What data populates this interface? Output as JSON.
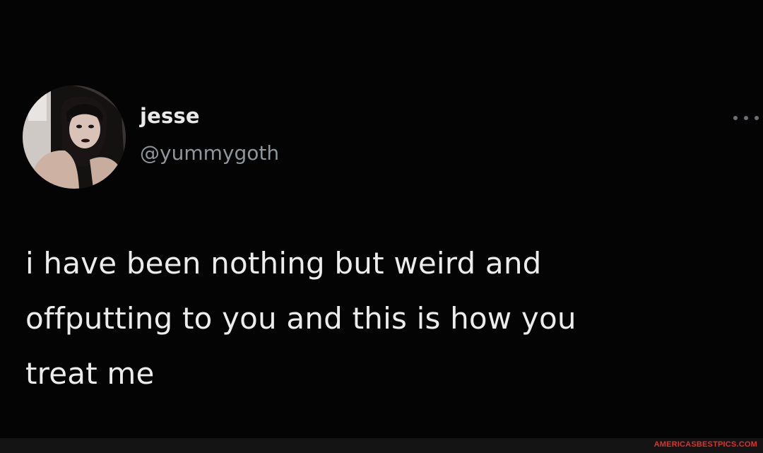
{
  "tweet": {
    "display_name": "jesse",
    "handle": "@yummygoth",
    "text_lines": [
      "i have been nothing but weird and",
      "offputting to you and this is how you",
      "treat me"
    ],
    "more_icon": "more-options-icon"
  },
  "footer": {
    "watermark": "AMERICASBESTPICS.COM"
  },
  "colors": {
    "background": "#040404",
    "name": "#e9e9e9",
    "handle": "#8f959a",
    "text": "#ececec",
    "watermark": "#e0312a"
  }
}
